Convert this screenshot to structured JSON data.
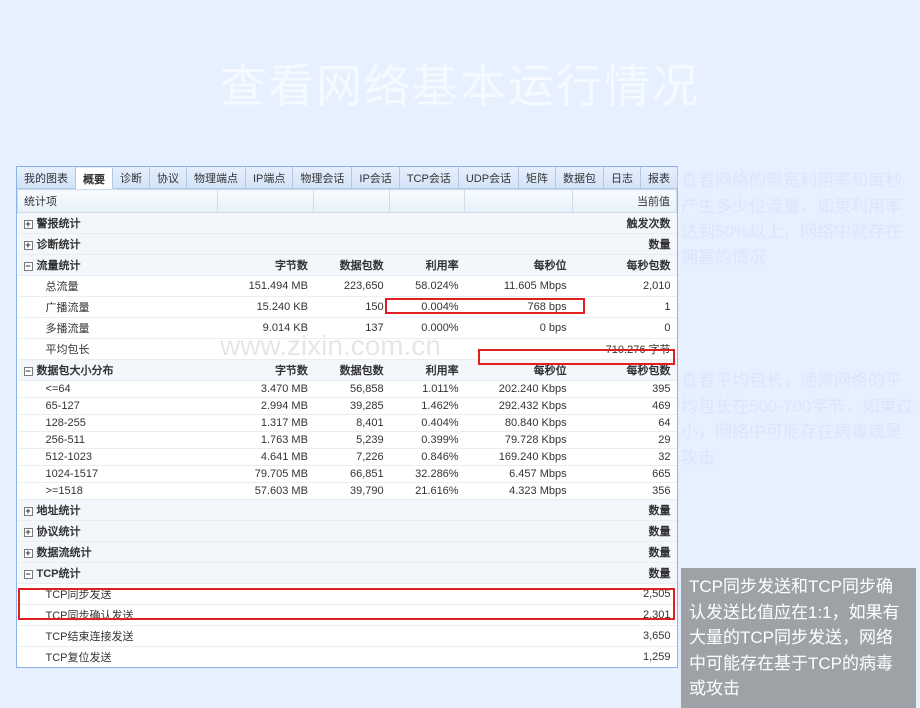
{
  "slide_title": "查看网络基本运行情况",
  "watermark": "www.zixin.com.cn",
  "side_notes": {
    "n1": "查看网络的带宽利用率和每秒产生多少位流量，如果利用率达到50%以上，网络中就存在拥塞的情况",
    "n2": "查看平均包长，通常网络的平均包长在500-700字节，如果过小，网络中可能存在病毒或是攻击",
    "n3": "TCP同步发送和TCP同步确认发送比值应在1:1，如果有大量的TCP同步发送，网络中可能存在基于TCP的病毒或攻击"
  },
  "tabs": [
    "我的图表",
    "概要",
    "诊断",
    "协议",
    "物理端点",
    "IP端点",
    "物理会话",
    "IP会话",
    "TCP会话",
    "UDP会话",
    "矩阵",
    "数据包",
    "日志",
    "报表"
  ],
  "active_tab": 1,
  "columns_main": [
    "统计项",
    "",
    "",
    "",
    "",
    "当前值"
  ],
  "columns_traffic": [
    "",
    "字节数",
    "数据包数",
    "利用率",
    "每秒位",
    "每秒包数"
  ],
  "columns_dist": [
    "",
    "字节数",
    "数据包数",
    "利用率",
    "每秒位",
    "每秒包数"
  ],
  "labels": {
    "alarm": "警报统计",
    "diag": "诊断统计",
    "traffic": "流量统计",
    "total": "总流量",
    "broadcast": "广播流量",
    "multicast": "多播流量",
    "avg_len": "平均包长",
    "pkt_dist": "数据包大小分布",
    "addr": "地址统计",
    "proto": "协议统计",
    "flow": "数据流统计",
    "tcp": "TCP统计",
    "tcp_syn": "TCP同步发送",
    "tcp_synack": "TCP同步确认发送",
    "tcp_fin": "TCP结束连接发送",
    "tcp_rst": "TCP复位发送",
    "trigger_count": "触发次数",
    "count": "数量",
    "avg_unit": "710.276 字节"
  },
  "traffic": {
    "total": {
      "bytes": "151.494 MB",
      "pkts": "223,650",
      "util": "58.024%",
      "bps": "11.605 Mbps",
      "pps": "2,010"
    },
    "broadcast": {
      "bytes": "15.240 KB",
      "pkts": "150",
      "util": "0.004%",
      "bps": "768 bps",
      "pps": "1"
    },
    "multicast": {
      "bytes": "9.014 KB",
      "pkts": "137",
      "util": "0.000%",
      "bps": "0 bps",
      "pps": "0"
    }
  },
  "dist": [
    {
      "range": "<=64",
      "bytes": "3.470 MB",
      "pkts": "56,858",
      "util": "1.011%",
      "bps": "202.240 Kbps",
      "pps": "395"
    },
    {
      "range": "65-127",
      "bytes": "2.994 MB",
      "pkts": "39,285",
      "util": "1.462%",
      "bps": "292.432 Kbps",
      "pps": "469"
    },
    {
      "range": "128-255",
      "bytes": "1.317 MB",
      "pkts": "8,401",
      "util": "0.404%",
      "bps": "80.840 Kbps",
      "pps": "64"
    },
    {
      "range": "256-511",
      "bytes": "1.763 MB",
      "pkts": "5,239",
      "util": "0.399%",
      "bps": "79.728 Kbps",
      "pps": "29"
    },
    {
      "range": "512-1023",
      "bytes": "4.641 MB",
      "pkts": "7,226",
      "util": "0.846%",
      "bps": "169.240 Kbps",
      "pps": "32"
    },
    {
      "range": "1024-1517",
      "bytes": "79.705 MB",
      "pkts": "66,851",
      "util": "32.286%",
      "bps": "6.457 Mbps",
      "pps": "665"
    },
    {
      "range": ">=1518",
      "bytes": "57.603 MB",
      "pkts": "39,790",
      "util": "21.616%",
      "bps": "4.323 Mbps",
      "pps": "356"
    }
  ],
  "tcp_stats": {
    "syn": "2,505",
    "synack": "2,301",
    "fin": "3,650",
    "rst": "1,259"
  }
}
